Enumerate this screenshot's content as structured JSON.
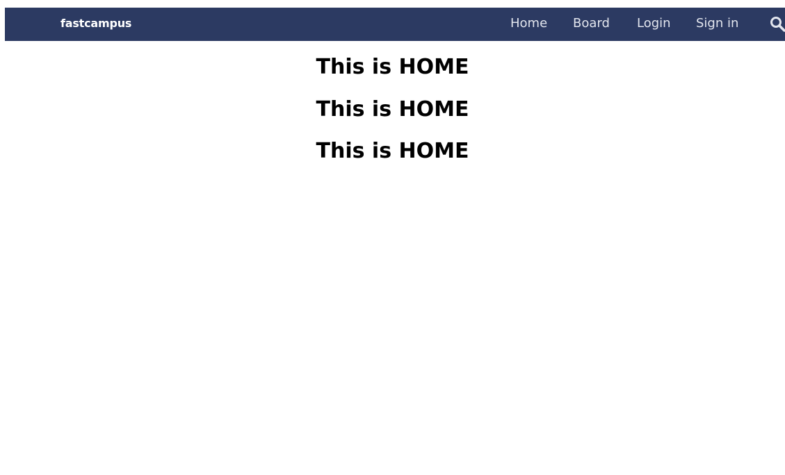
{
  "navbar": {
    "brand": "fastcampus",
    "links": [
      {
        "label": "Home"
      },
      {
        "label": "Board"
      },
      {
        "label": "Login"
      },
      {
        "label": "Sign in"
      }
    ],
    "search_icon": "search-icon",
    "bg_color": "#2c3a62"
  },
  "main": {
    "headings": [
      {
        "text": "This is HOME"
      },
      {
        "text": "This is HOME"
      },
      {
        "text": "This is HOME"
      }
    ]
  }
}
